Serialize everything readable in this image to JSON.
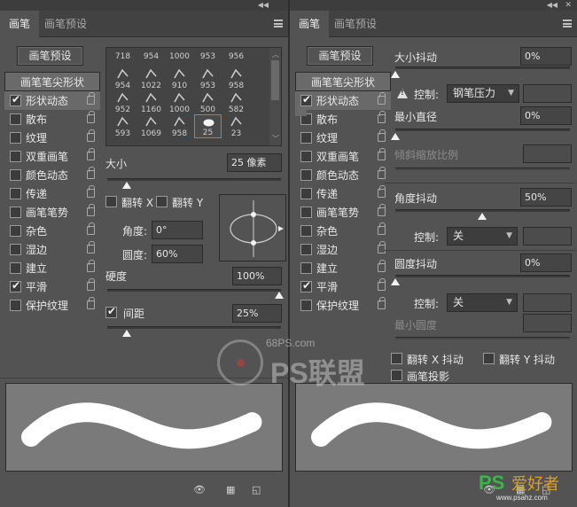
{
  "left": {
    "tabs": [
      "画笔",
      "画笔预设"
    ],
    "preset_button": "画笔预设",
    "list": [
      {
        "label": "画笔笔尖形状",
        "checked": null
      },
      {
        "label": "形状动态",
        "checked": true
      },
      {
        "label": "散布",
        "checked": false
      },
      {
        "label": "纹理",
        "checked": false
      },
      {
        "label": "双重画笔",
        "checked": false
      },
      {
        "label": "颜色动态",
        "checked": false
      },
      {
        "label": "传递",
        "checked": false
      },
      {
        "label": "画笔笔势",
        "checked": false
      },
      {
        "label": "杂色",
        "checked": false
      },
      {
        "label": "湿边",
        "checked": false
      },
      {
        "label": "建立",
        "checked": false
      },
      {
        "label": "平滑",
        "checked": true
      },
      {
        "label": "保护纹理",
        "checked": false
      }
    ],
    "brush_sizes": [
      "718",
      "954",
      "1000",
      "953",
      "956",
      "954",
      "1022",
      "910",
      "953",
      "958",
      "952",
      "1160",
      "1000",
      "500",
      "582",
      "593",
      "1069",
      "958",
      "25",
      "23"
    ],
    "size_label": "大小",
    "size_value": "25 像素",
    "flip_x": "翻转 X",
    "flip_y": "翻转 Y",
    "angle_label": "角度:",
    "angle_value": "0°",
    "roundness_label": "圆度:",
    "roundness_value": "60%",
    "hardness_label": "硬度",
    "hardness_value": "100%",
    "spacing_label": "间距",
    "spacing_value": "25%"
  },
  "right": {
    "tabs": [
      "画笔",
      "画笔预设"
    ],
    "preset_button": "画笔预设",
    "list": [
      {
        "label": "画笔笔尖形状",
        "checked": null
      },
      {
        "label": "形状动态",
        "checked": true
      },
      {
        "label": "散布",
        "checked": false
      },
      {
        "label": "纹理",
        "checked": false
      },
      {
        "label": "双重画笔",
        "checked": false
      },
      {
        "label": "颜色动态",
        "checked": false
      },
      {
        "label": "传递",
        "checked": false
      },
      {
        "label": "画笔笔势",
        "checked": false
      },
      {
        "label": "杂色",
        "checked": false
      },
      {
        "label": "湿边",
        "checked": false
      },
      {
        "label": "建立",
        "checked": false
      },
      {
        "label": "平滑",
        "checked": true
      },
      {
        "label": "保护纹理",
        "checked": false
      }
    ],
    "size_jitter_label": "大小抖动",
    "size_jitter_value": "0%",
    "control_label": "控制:",
    "control_value_1": "钢笔压力",
    "min_diameter_label": "最小直径",
    "min_diameter_value": "0%",
    "tilt_scale_label": "倾斜缩放比例",
    "angle_jitter_label": "角度抖动",
    "angle_jitter_value": "50%",
    "control_value_2": "关",
    "roundness_jitter_label": "圆度抖动",
    "roundness_jitter_value": "0%",
    "control_value_3": "关",
    "min_roundness_label": "最小圆度",
    "flip_x_jitter": "翻转 X 抖动",
    "flip_y_jitter": "翻转 Y 抖动",
    "brush_projection": "画笔投影"
  },
  "watermark": {
    "site": "68PS.com",
    "brand": "PS联盟",
    "corner_logo": "PS",
    "corner_text": "爱好者",
    "corner_url": "www.psahz.com"
  }
}
